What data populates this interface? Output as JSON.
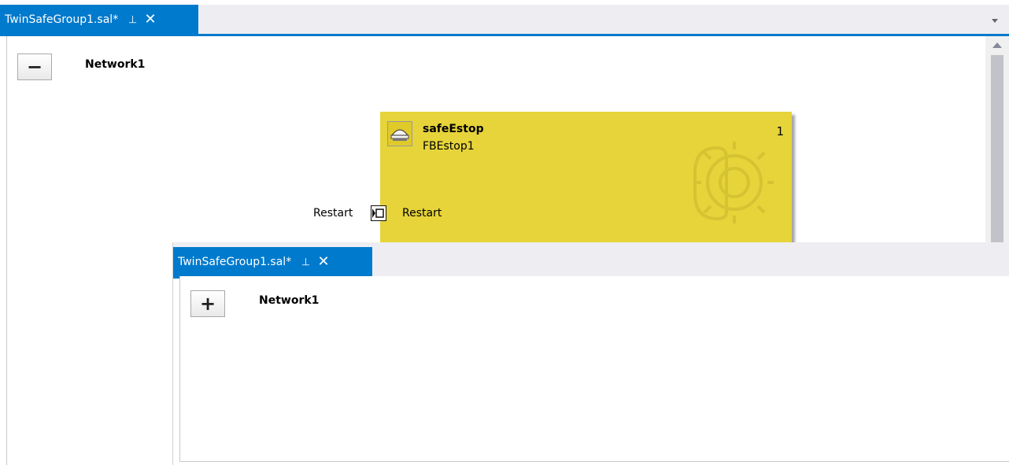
{
  "back_window": {
    "tab": {
      "title": "TwinSafeGroup1.sal*",
      "pin_glyph": "⊣",
      "close_glyph": "✕"
    },
    "network": {
      "toggle_glyph": "−",
      "label": "Network1"
    },
    "function_block": {
      "type_name": "safeEstop",
      "instance_name": "FBEstop1",
      "execution_order": "1",
      "color": "#e6d43a",
      "icon": "estop-button-icon",
      "watermark": "safety-gear-icon",
      "input_pin": {
        "external_label": "Restart",
        "internal_label": "Restart"
      }
    }
  },
  "front_window": {
    "tab": {
      "title": "TwinSafeGroup1.sal*",
      "pin_glyph": "⊣",
      "close_glyph": "✕"
    },
    "network": {
      "toggle_glyph": "+",
      "label": "Network1"
    }
  },
  "colors": {
    "tab_active": "#007acc",
    "tabstrip": "#eeeef2",
    "block_yellow": "#e6d43a"
  }
}
